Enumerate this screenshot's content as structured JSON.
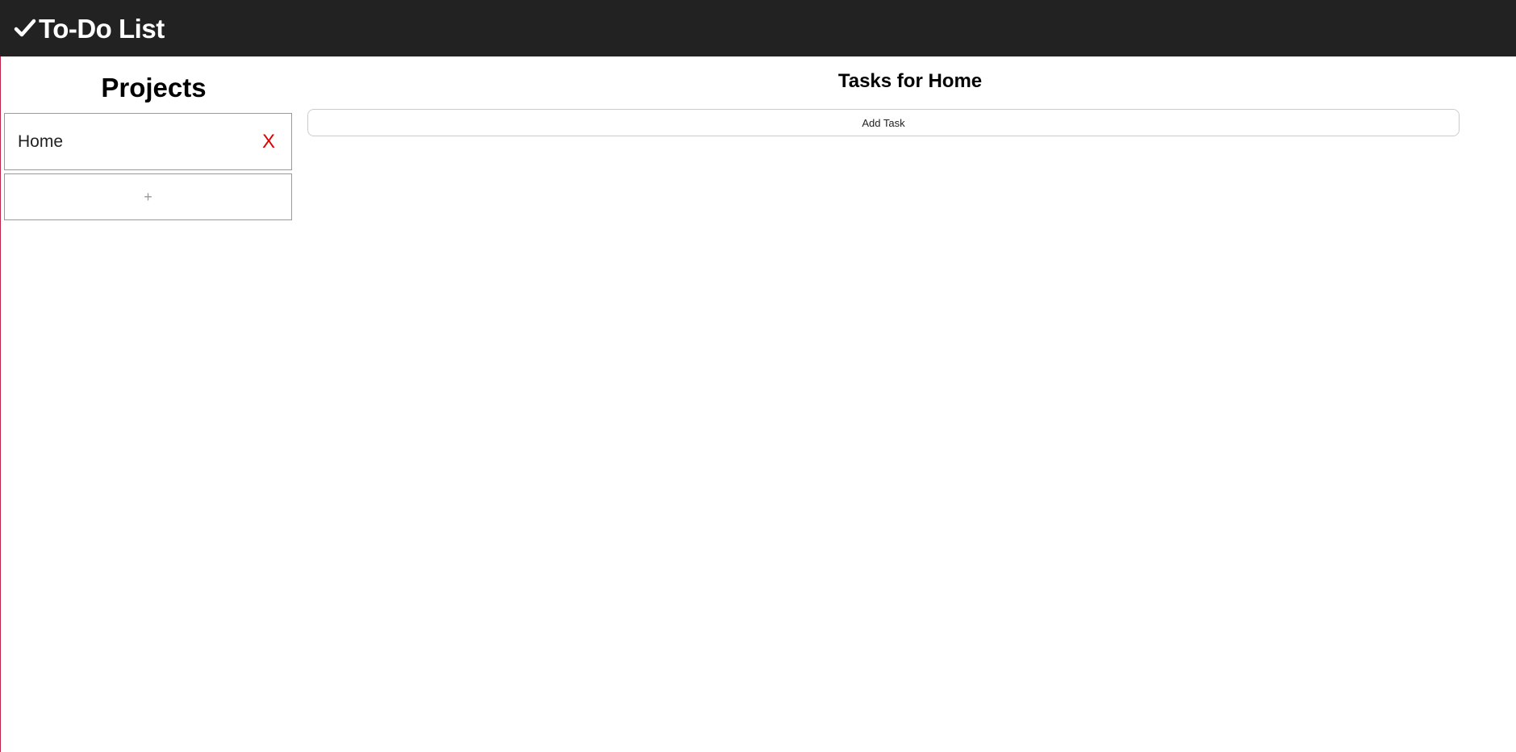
{
  "header": {
    "logo_icon": "check-icon",
    "title": "To-Do List",
    "background": "#222222"
  },
  "sidebar": {
    "title": "Projects",
    "projects": [
      {
        "name": "Home",
        "delete_label": "X"
      }
    ],
    "add_project_label": "+"
  },
  "main": {
    "title": "Tasks for Home",
    "add_task_label": "Add Task"
  },
  "colors": {
    "delete": "#e00000",
    "border": "#999999"
  }
}
